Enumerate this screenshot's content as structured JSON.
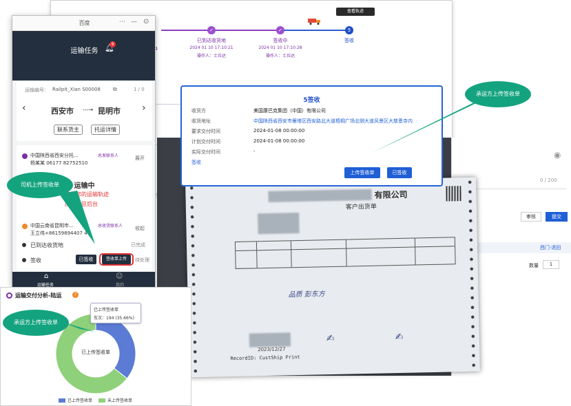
{
  "background_page": {
    "track_button": "查看轨迹",
    "steps": [
      {
        "label": "已到达收货地",
        "date": "2024 01 10 17:10:21",
        "by": "操作人：士兵达",
        "num": "✓"
      },
      {
        "label": "签收中",
        "date": "2024 01 10 17:10:28",
        "by": "操作人：士兵达",
        "num": "✓"
      },
      {
        "label": "签收",
        "date": "",
        "by": "",
        "num": "5"
      }
    ],
    "left_partial_num": "04"
  },
  "sign_card": {
    "title": "5签收",
    "rows": [
      {
        "label": "收货方",
        "value": "美国康巴克集团（中国）有限公司"
      },
      {
        "label": "收货地址",
        "value": "中国陕西省西安市雁塔区西安路北大道梧桐广场北侧大道风景区大慈恩寺内"
      },
      {
        "label": "要求交付时间",
        "value": "2024-01-08 00:00:00"
      },
      {
        "label": "计划交付时间",
        "value": "2024-01-08 00:00:00"
      },
      {
        "label": "实际交付时间",
        "value": "-"
      }
    ],
    "link": "签收",
    "btn_upload": "上传签收单",
    "btn_sign": "已签收"
  },
  "receipt": {
    "company": "有限公司",
    "subtitle": "客户出货单",
    "signer": "品质  彭东方",
    "footer_left": "2023/12/27",
    "record_id": "RecordID: CustShip Print"
  },
  "right_panel": {
    "count": "0 / 200",
    "btn_review": "审核",
    "btn_submit": "提交",
    "tab": "西门·退回",
    "qty_label": "数量",
    "qty_value": "1"
  },
  "phone": {
    "title": "百度",
    "header_title": "运输任务",
    "badge": "9",
    "waybill_label": "运输编号：",
    "waybill_no": "Railpit_Xian S00008",
    "page": "1 / 0",
    "origin": "西安市",
    "dest": "昆明市",
    "btn_contact": "联系货主",
    "btn_detail": "托运详情",
    "shipper_company": "中国陕西省西安分托...",
    "shipper_contact": "杨某某 06177 82752510",
    "shipper_note": "总发联系人",
    "expand": "展开",
    "status": "运输中",
    "status_msg1": "获取您的运输轨迹",
    "status_msg2": "应用常驻后台",
    "receiver_company": "中国云南省昆明市...",
    "receiver_contact": "王立伟+86159894407 47",
    "receiver_note": "总收货联系人",
    "collapse": "收起",
    "arrived": "已到达收货地",
    "arrived_state": "已完成",
    "sign": "签收",
    "btn_sign": "已签收",
    "btn_upload": "签收单上传",
    "sign_state": "待处理",
    "tab_task": "运输任务",
    "tab_me": "我的"
  },
  "analytics": {
    "title": "运输交付分析-陆运",
    "tooltip_title": "已上传签收单",
    "tooltip_value": "车次：194 (35.66%)",
    "center_label": "已上传签收单",
    "legend": [
      {
        "label": "已上传签收单",
        "color": "#5b7bd5"
      },
      {
        "label": "未上传签收单",
        "color": "#8fd07a"
      }
    ]
  },
  "chart_data": {
    "type": "pie",
    "title": "运输交付分析-陆运",
    "categories": [
      "已上传签收单",
      "未上传签收单"
    ],
    "values": [
      35.66,
      64.34
    ]
  },
  "callouts": {
    "driver_upload": "司机上传签收单",
    "carrier_upload_top": "承运方上传签收单",
    "carrier_upload_bottom": "承运方上传签收单"
  },
  "colors": {
    "accent_purple": "#7b2ea6",
    "blue": "#1f5fd6",
    "callout_green": "#14a37f",
    "phone_dark": "#232f3e"
  }
}
